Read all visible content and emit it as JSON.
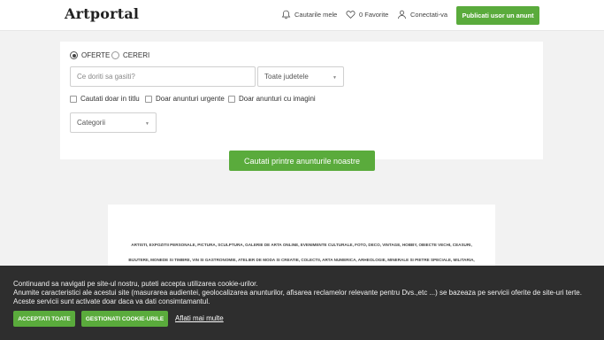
{
  "header": {
    "logo": "Artportal",
    "saved_searches": "Cautarile mele",
    "favorites": "0 Favorite",
    "login": "Conectati-va",
    "publish": "Publicati usor un anunt",
    "icons": [
      "bell-icon",
      "heart-icon",
      "user-icon"
    ]
  },
  "search": {
    "radio_offers": "OFERTE",
    "radio_requests": "CERERI",
    "radio_selected": "OFERTE",
    "query_placeholder": "Ce doriti sa gasiti?",
    "query_value": "",
    "county_select": "Toate judetele",
    "check_title": "Cautati doar in titlu",
    "check_urgent": "Doar anunturi urgente",
    "check_images": "Doar anunturi cu imagini",
    "category_select": "Categorii",
    "submit": "Cautati printre anunturile noastre"
  },
  "categories": {
    "line1": "ARTISTI, EXPOZITII PERSONALE, PICTURA, SCULPTURA, GALERIE DE ARTA ONLINE, EVENIMENTE CULTURALE, FOTO, DECO, VINTAGE, HOBBY, OBIECTE VECHI, CEASURI,",
    "line2": "BIJUTERII, MONEDE SI TIMBRE, VIN SI GASTRONOMIE, ATELIER DE MODA SI CREATIE, COLECTII, ARTA NUMERICA, ARHEOLOGIE, MINERALE SI PIETRE SPECIALE, MILITARIA,"
  },
  "cookie": {
    "line1": "Continuand sa navigati pe site-ul nostru, puteti accepta utilizarea cookie-urilor.",
    "line2": "Anumite caracteristici ale acestui site (masurarea audientei, geolocalizarea anunturilor, afisarea reclamelor relevante pentru Dvs.,etc ...) se bazeaza pe servicii oferite de site-uri terte.",
    "line3": "Aceste servicii sunt activate doar daca va dati consimtamantul.",
    "accept_all": "ACCEPTATI TOATE",
    "manage": "GESTIONATI COOKIE-URILE",
    "learn_more": "Aflati mai multe"
  },
  "colors": {
    "accent": "#5aab3c",
    "cookie_bg": "#2e2e2e",
    "page_bg": "#f2f2f2"
  }
}
